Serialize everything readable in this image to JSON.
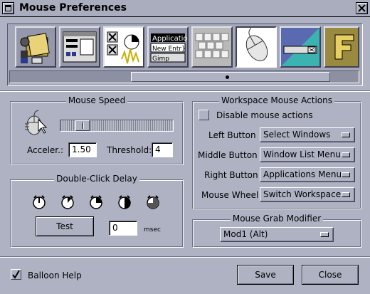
{
  "window": {
    "title": "Mouse Preferences"
  },
  "colors": {
    "panel_bg": "#aeb2c3",
    "title_bar": "#a9adbd",
    "selected_tile": "#ffffff"
  },
  "icon_strip": {
    "tiles": [
      {
        "icon": "file-manager-icon",
        "selected": false
      },
      {
        "icon": "window-appearance-icon",
        "selected": false
      },
      {
        "icon": "window-buttons-icon",
        "selected": false
      },
      {
        "icon": "applications-menu-icon",
        "selected": false,
        "menu_lines": [
          "Applicatio",
          "New Entr}",
          "Gimp"
        ]
      },
      {
        "icon": "keyboard-icon",
        "selected": false
      },
      {
        "icon": "mouse-icon",
        "selected": true
      },
      {
        "icon": "background-icon",
        "selected": false
      },
      {
        "icon": "font-icon",
        "selected": false
      }
    ]
  },
  "mouse_speed": {
    "title": "Mouse Speed",
    "slider_level": 0.15,
    "acceleration_label": "Acceler.:",
    "acceleration_value": "1.50",
    "threshold_label": "Threshold:",
    "threshold_value": "4"
  },
  "double_click": {
    "title": "Double-Click Delay",
    "clocks": [
      "clock-1-icon",
      "clock-2-icon",
      "clock-3-icon",
      "clock-4-icon",
      "clock-5-icon"
    ],
    "test_label": "Test",
    "delay_value": "0",
    "unit": "msec"
  },
  "workspace_actions": {
    "title": "Workspace Mouse Actions",
    "disable_label": "Disable mouse actions",
    "disable_checked": false,
    "rows": [
      {
        "label": "Left Button",
        "value": "Select Windows"
      },
      {
        "label": "Middle Button",
        "value": "Window List Menu"
      },
      {
        "label": "Right Button",
        "value": "Applications Menu"
      },
      {
        "label": "Mouse Wheel",
        "value": "Switch Workspaces"
      }
    ]
  },
  "grab_modifier": {
    "title": "Mouse Grab Modifier",
    "value": "Mod1 (Alt)"
  },
  "footer": {
    "balloon_help_label": "Balloon Help",
    "balloon_help_checked": true,
    "save_label": "Save",
    "close_label": "Close"
  }
}
